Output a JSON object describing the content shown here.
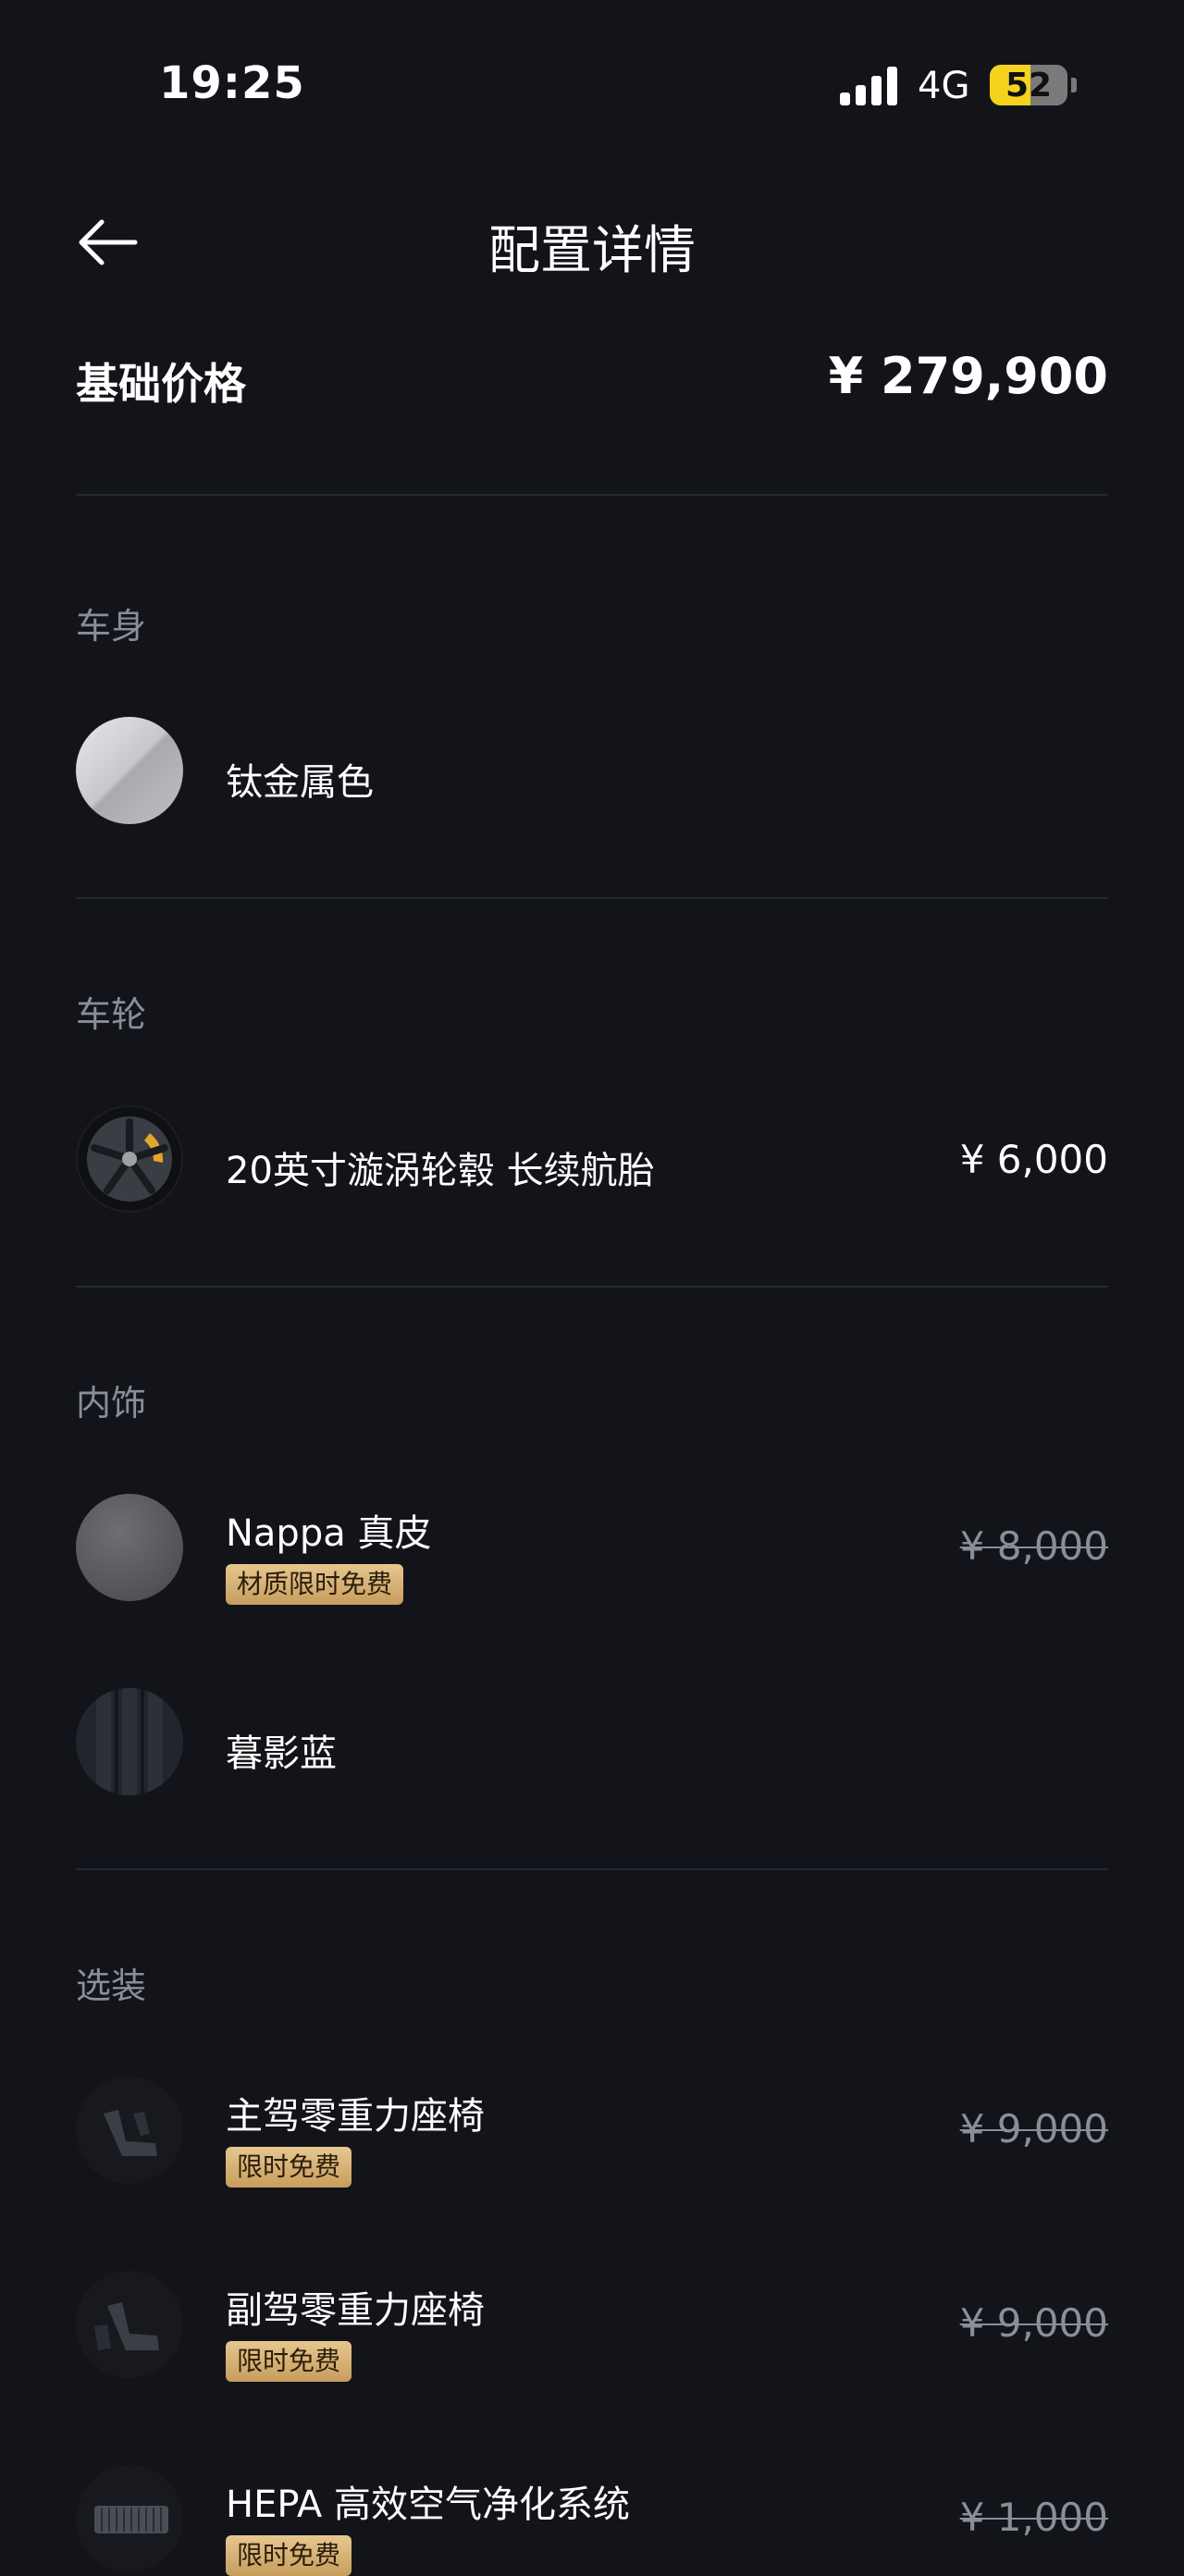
{
  "status_bar": {
    "time": "19:25",
    "network": "4G",
    "battery": "52",
    "battery_level_percent": 52
  },
  "header": {
    "title": "配置详情",
    "back_icon": "arrow-left-icon"
  },
  "base": {
    "label": "基础价格",
    "price": "¥ 279,900"
  },
  "sections": {
    "body": {
      "title": "车身",
      "items": [
        {
          "name": "钛金属色",
          "thumb": "paint-swatch-silver"
        }
      ]
    },
    "wheels": {
      "title": "车轮",
      "items": [
        {
          "name": "20英寸漩涡轮毂 长续航胎",
          "price": "¥ 6,000",
          "thumb": "wheel-image"
        }
      ]
    },
    "interior": {
      "title": "内饰",
      "items": [
        {
          "name": "Nappa 真皮",
          "badge": "材质限时免费",
          "price": "¥ 8,000",
          "thumb": "leather-swatch-gray"
        },
        {
          "name": "暮影蓝",
          "thumb": "interior-swatch-blue"
        }
      ]
    },
    "options": {
      "title": "选装",
      "items": [
        {
          "name": "主驾零重力座椅",
          "badge": "限时免费",
          "price": "¥ 9,000",
          "thumb": "seat-image"
        },
        {
          "name": "副驾零重力座椅",
          "badge": "限时免费",
          "price": "¥ 9,000",
          "thumb": "seat-image"
        },
        {
          "name": "HEPA 高效空气净化系统",
          "badge": "限时免费",
          "price": "¥ 1,000",
          "thumb": "air-filter-image"
        }
      ]
    }
  }
}
